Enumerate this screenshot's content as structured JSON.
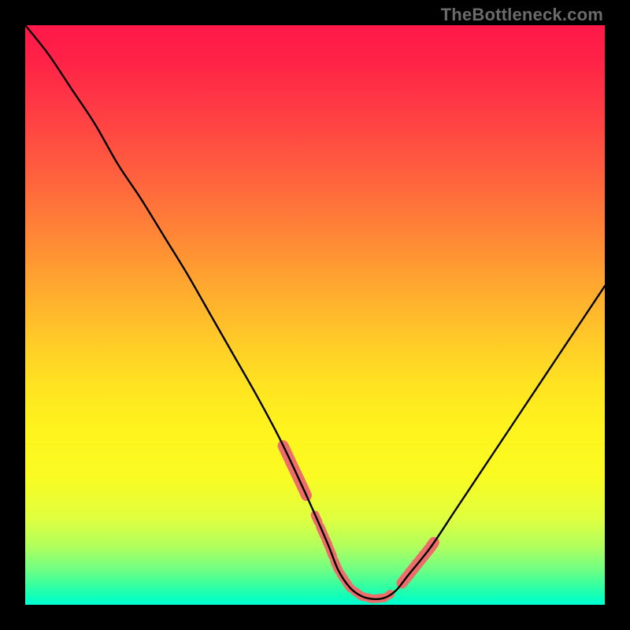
{
  "watermark": "TheBottleneck.com",
  "colors": {
    "background": "#000000",
    "curve": "#000000",
    "highlight": "#ec6d6a",
    "gradient_top": "#ff1848",
    "gradient_bottom": "#00ffd0"
  },
  "chart_data": {
    "type": "line",
    "title": "",
    "xlabel": "",
    "ylabel": "",
    "xlim": [
      0,
      100
    ],
    "ylim": [
      0,
      100
    ],
    "grid": false,
    "legend": false,
    "notes": "Bottleneck-style V curve. y≈100 means worst (top/red), y≈0 means optimal (bottom/green). Left branch falls steeply with convex shape; minimum plateau roughly x 54–63 at y≈1; right branch rises concavely. Pink overlay segments mark the near-optimal zone along the curve.",
    "curve": {
      "x": [
        0,
        4,
        8,
        12,
        16,
        20,
        24,
        28,
        32,
        36,
        40,
        44,
        48,
        52,
        54,
        56,
        58,
        60,
        62,
        64,
        66,
        70,
        74,
        78,
        82,
        86,
        90,
        94,
        98,
        100
      ],
      "y": [
        100,
        95,
        89,
        83,
        76,
        70,
        63.5,
        57,
        50,
        43,
        36,
        28.5,
        20,
        11,
        6,
        3,
        1.5,
        1,
        1.2,
        2.5,
        5,
        10,
        16,
        22,
        28,
        34,
        40,
        46,
        52,
        55
      ]
    },
    "highlight_segments": [
      {
        "x_start": 44.5,
        "x_end": 48.5,
        "style": "thick"
      },
      {
        "x_start": 50.0,
        "x_end": 63.0,
        "style": "uneven"
      },
      {
        "x_start": 65.0,
        "x_end": 70.5,
        "style": "thick"
      }
    ],
    "highlight_ticks_x": [
      65.8,
      67.0,
      68.2,
      69.4
    ]
  }
}
